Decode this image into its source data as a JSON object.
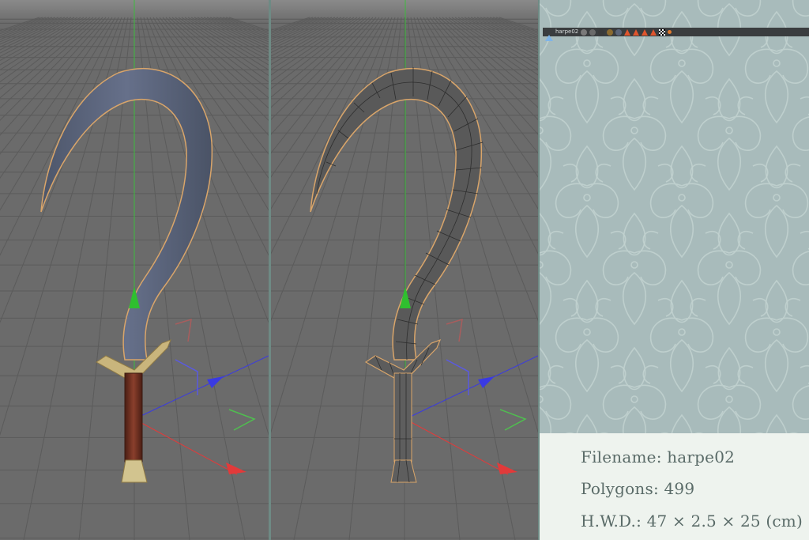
{
  "viewports": [
    {
      "name": "shaded",
      "mode": "shaded"
    },
    {
      "name": "wireframe",
      "mode": "shaded-wire"
    }
  ],
  "scene_bar": {
    "object_name": "harpe02",
    "tag_icons": [
      "texture-tag-icon",
      "texture-tag-icon",
      "material-sphere-icon",
      "material-sphere-icon",
      "material-sphere-icon",
      "phong-tag-icon",
      "phong-tag-icon",
      "phong-tag-icon",
      "phong-tag-icon",
      "uvw-tag-icon",
      "selection-tag-icon"
    ]
  },
  "info": {
    "filename": "Filename: harpe02",
    "polygons": "Polygons: 499",
    "hwd": "H.W.D.: 47 × 2.5 × 25 (cm)"
  },
  "colors": {
    "viewport_bg": "#6b6b6b",
    "grid": "#5a5a5a",
    "blade": "#5a6478",
    "blade_outline": "#d9a56a",
    "guard": "#c9b57c",
    "handle": "#6b2d1f",
    "panel_bg": "#a8bbbb",
    "info_bg": "#eef3ee",
    "info_text": "#5a6b68",
    "axis_x": "#e23a3a",
    "axis_y": "#2fbf2f",
    "axis_z": "#3a3ae2"
  }
}
